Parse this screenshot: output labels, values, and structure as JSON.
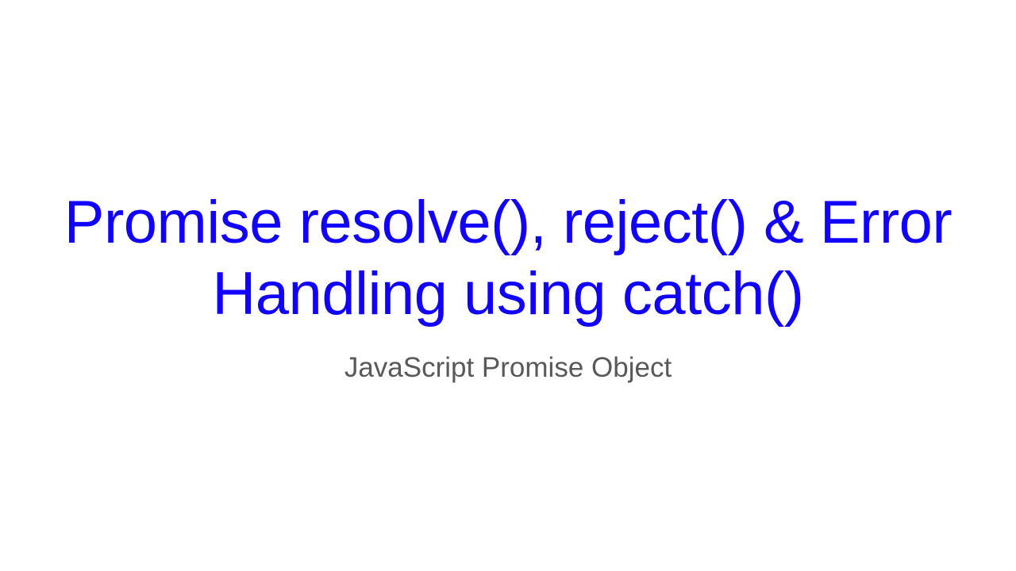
{
  "slide": {
    "title": "Promise resolve(), reject() & Error Handling using catch()",
    "subtitle": "JavaScript Promise Object"
  }
}
